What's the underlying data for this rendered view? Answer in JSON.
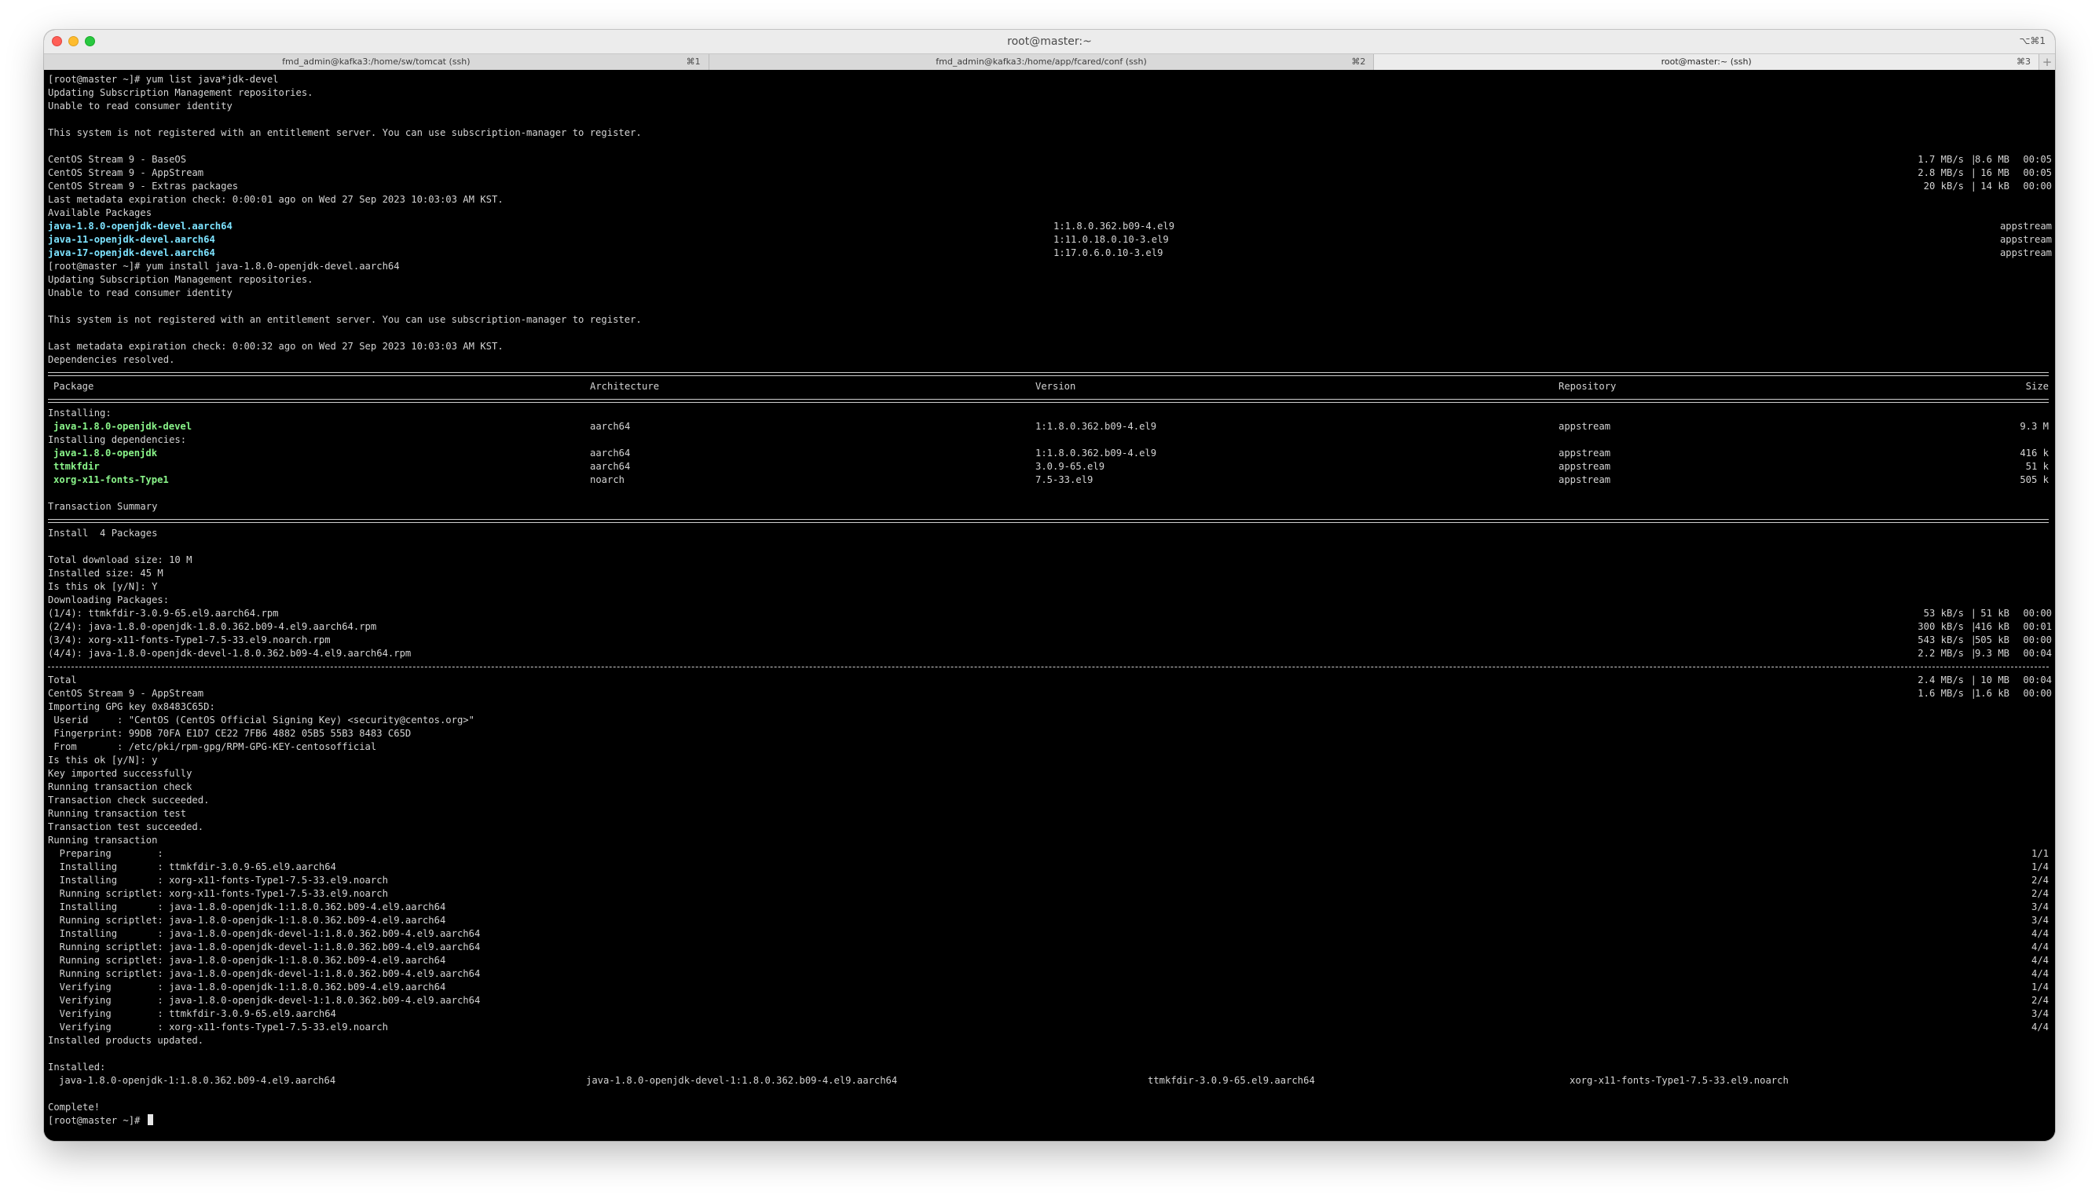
{
  "window": {
    "title": "root@master:~",
    "shortcut": "⌥⌘1"
  },
  "tabs": [
    {
      "label": "fmd_admin@kafka3:/home/sw/tomcat (ssh)",
      "key": "⌘1"
    },
    {
      "label": "fmd_admin@kafka3:/home/app/fcared/conf (ssh)",
      "key": "⌘2"
    },
    {
      "label": "root@master:~ (ssh)",
      "key": "⌘3"
    }
  ],
  "tab_add_label": "+",
  "term": {
    "cmd1": "[root@master ~]# yum list java*jdk-devel",
    "updating": "Updating Subscription Management repositories.",
    "unable": "Unable to read consumer identity",
    "not_registered": "This system is not registered with an entitlement server. You can use subscription-manager to register.",
    "repos": [
      {
        "name": "CentOS Stream 9 - BaseOS",
        "speed": "1.7 MB/s",
        "size": "8.6 MB",
        "time": "00:05"
      },
      {
        "name": "CentOS Stream 9 - AppStream",
        "speed": "2.8 MB/s",
        "size": " 16 MB",
        "time": "00:05"
      },
      {
        "name": "CentOS Stream 9 - Extras packages",
        "speed": " 20 kB/s",
        "size": " 14 kB",
        "time": "00:00"
      }
    ],
    "meta_check1": "Last metadata expiration check: 0:00:01 ago on Wed 27 Sep 2023 10:03:03 AM KST.",
    "available": "Available Packages",
    "list_pkgs": [
      {
        "name": "java-1.8.0-openjdk-devel.aarch64",
        "version": "1:1.8.0.362.b09-4.el9",
        "repo": "appstream"
      },
      {
        "name": "java-11-openjdk-devel.aarch64",
        "version": "1:11.0.18.0.10-3.el9",
        "repo": "appstream"
      },
      {
        "name": "java-17-openjdk-devel.aarch64",
        "version": "1:17.0.6.0.10-3.el9",
        "repo": "appstream"
      }
    ],
    "cmd2": "[root@master ~]# yum install java-1.8.0-openjdk-devel.aarch64",
    "meta_check2": "Last metadata expiration check: 0:00:32 ago on Wed 27 Sep 2023 10:03:03 AM KST.",
    "deps_resolved": "Dependencies resolved.",
    "table_headers": {
      "package": "Package",
      "arch": "Architecture",
      "version": "Version",
      "repo": "Repository",
      "size": "Size"
    },
    "installing_label": "Installing:",
    "installing": [
      {
        "name": "java-1.8.0-openjdk-devel",
        "arch": "aarch64",
        "version": "1:1.8.0.362.b09-4.el9",
        "repo": "appstream",
        "size": "9.3 M"
      }
    ],
    "installing_deps_label": "Installing dependencies:",
    "deps": [
      {
        "name": "java-1.8.0-openjdk",
        "arch": "aarch64",
        "version": "1:1.8.0.362.b09-4.el9",
        "repo": "appstream",
        "size": "416 k"
      },
      {
        "name": "ttmkfdir",
        "arch": "aarch64",
        "version": "3.0.9-65.el9",
        "repo": "appstream",
        "size": "51 k"
      },
      {
        "name": "xorg-x11-fonts-Type1",
        "arch": "noarch",
        "version": "7.5-33.el9",
        "repo": "appstream",
        "size": "505 k"
      }
    ],
    "txn_summary": "Transaction Summary",
    "install_count": "Install  4 Packages",
    "total_download": "Total download size: 10 M",
    "installed_size": "Installed size: 45 M",
    "is_ok_1": "Is this ok [y/N]: Y",
    "downloading": "Downloading Packages:",
    "downloads": [
      {
        "name": "(1/4): ttmkfdir-3.0.9-65.el9.aarch64.rpm",
        "speed": " 53 kB/s",
        "size": " 51 kB",
        "time": "00:00"
      },
      {
        "name": "(2/4): java-1.8.0-openjdk-1.8.0.362.b09-4.el9.aarch64.rpm",
        "speed": "300 kB/s",
        "size": "416 kB",
        "time": "00:01"
      },
      {
        "name": "(3/4): xorg-x11-fonts-Type1-7.5-33.el9.noarch.rpm",
        "speed": "543 kB/s",
        "size": "505 kB",
        "time": "00:00"
      },
      {
        "name": "(4/4): java-1.8.0-openjdk-devel-1.8.0.362.b09-4.el9.aarch64.rpm",
        "speed": "2.2 MB/s",
        "size": "9.3 MB",
        "time": "00:04"
      }
    ],
    "total_row": {
      "name": "Total",
      "speed": "2.4 MB/s",
      "size": " 10 MB",
      "time": "00:04"
    },
    "appstream_row": {
      "name": "CentOS Stream 9 - AppStream",
      "speed": "1.6 MB/s",
      "size": "1.6 kB",
      "time": "00:00"
    },
    "gpg_lines": [
      "Importing GPG key 0x8483C65D:",
      " Userid     : \"CentOS (CentOS Official Signing Key) <security@centos.org>\"",
      " Fingerprint: 99DB 70FA E1D7 CE22 7FB6 4882 05B5 55B3 8483 C65D",
      " From       : /etc/pki/rpm-gpg/RPM-GPG-KEY-centosofficial",
      "Is this ok [y/N]: y",
      "Key imported successfully",
      "Running transaction check",
      "Transaction check succeeded.",
      "Running transaction test",
      "Transaction test succeeded.",
      "Running transaction"
    ],
    "steps": [
      {
        "text": "  Preparing        :",
        "count": "1/1"
      },
      {
        "text": "  Installing       : ttmkfdir-3.0.9-65.el9.aarch64",
        "count": "1/4"
      },
      {
        "text": "  Installing       : xorg-x11-fonts-Type1-7.5-33.el9.noarch",
        "count": "2/4"
      },
      {
        "text": "  Running scriptlet: xorg-x11-fonts-Type1-7.5-33.el9.noarch",
        "count": "2/4"
      },
      {
        "text": "  Installing       : java-1.8.0-openjdk-1:1.8.0.362.b09-4.el9.aarch64",
        "count": "3/4"
      },
      {
        "text": "  Running scriptlet: java-1.8.0-openjdk-1:1.8.0.362.b09-4.el9.aarch64",
        "count": "3/4"
      },
      {
        "text": "  Installing       : java-1.8.0-openjdk-devel-1:1.8.0.362.b09-4.el9.aarch64",
        "count": "4/4"
      },
      {
        "text": "  Running scriptlet: java-1.8.0-openjdk-devel-1:1.8.0.362.b09-4.el9.aarch64",
        "count": "4/4"
      },
      {
        "text": "  Running scriptlet: java-1.8.0-openjdk-1:1.8.0.362.b09-4.el9.aarch64",
        "count": "4/4"
      },
      {
        "text": "  Running scriptlet: java-1.8.0-openjdk-devel-1:1.8.0.362.b09-4.el9.aarch64",
        "count": "4/4"
      },
      {
        "text": "  Verifying        : java-1.8.0-openjdk-1:1.8.0.362.b09-4.el9.aarch64",
        "count": "1/4"
      },
      {
        "text": "  Verifying        : java-1.8.0-openjdk-devel-1:1.8.0.362.b09-4.el9.aarch64",
        "count": "2/4"
      },
      {
        "text": "  Verifying        : ttmkfdir-3.0.9-65.el9.aarch64",
        "count": "3/4"
      },
      {
        "text": "  Verifying        : xorg-x11-fonts-Type1-7.5-33.el9.noarch",
        "count": "4/4"
      }
    ],
    "products_updated": "Installed products updated.",
    "installed_label": "Installed:",
    "installed_items": [
      "java-1.8.0-openjdk-1:1.8.0.362.b09-4.el9.aarch64",
      "java-1.8.0-openjdk-devel-1:1.8.0.362.b09-4.el9.aarch64",
      "ttmkfdir-3.0.9-65.el9.aarch64",
      "xorg-x11-fonts-Type1-7.5-33.el9.noarch"
    ],
    "complete": "Complete!",
    "prompt": "[root@master ~]# "
  }
}
